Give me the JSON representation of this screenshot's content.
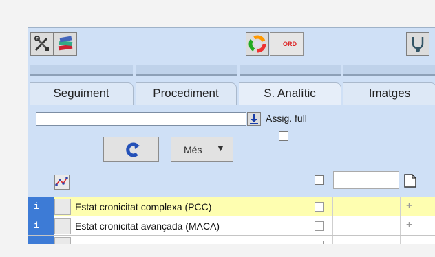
{
  "toolbar": {
    "icons": [
      "tools-icon",
      "books-icon",
      "refresh-circle-icon",
      "stethoscope-icon"
    ],
    "ord_label": "ORD"
  },
  "tabs": [
    {
      "label": "Seguiment"
    },
    {
      "label": "Procediment"
    },
    {
      "label": "S. Analític"
    },
    {
      "label": "Imatges"
    }
  ],
  "filter": {
    "value": "",
    "assig_label": "Assig. full",
    "assig_checked": false
  },
  "actions": {
    "mes_label": "Més"
  },
  "rows": [
    {
      "info": "i",
      "label": "Estat cronicitat complexa (PCC)",
      "highlight": true,
      "checked": false,
      "add": "+"
    },
    {
      "info": "i",
      "label": "Estat cronicitat avançada (MACA)",
      "highlight": false,
      "checked": false,
      "add": "+"
    }
  ],
  "colors": {
    "panel": "#cfe0f6",
    "highlight_row": "#fefeb0",
    "info_cell": "#3d7bd6"
  }
}
